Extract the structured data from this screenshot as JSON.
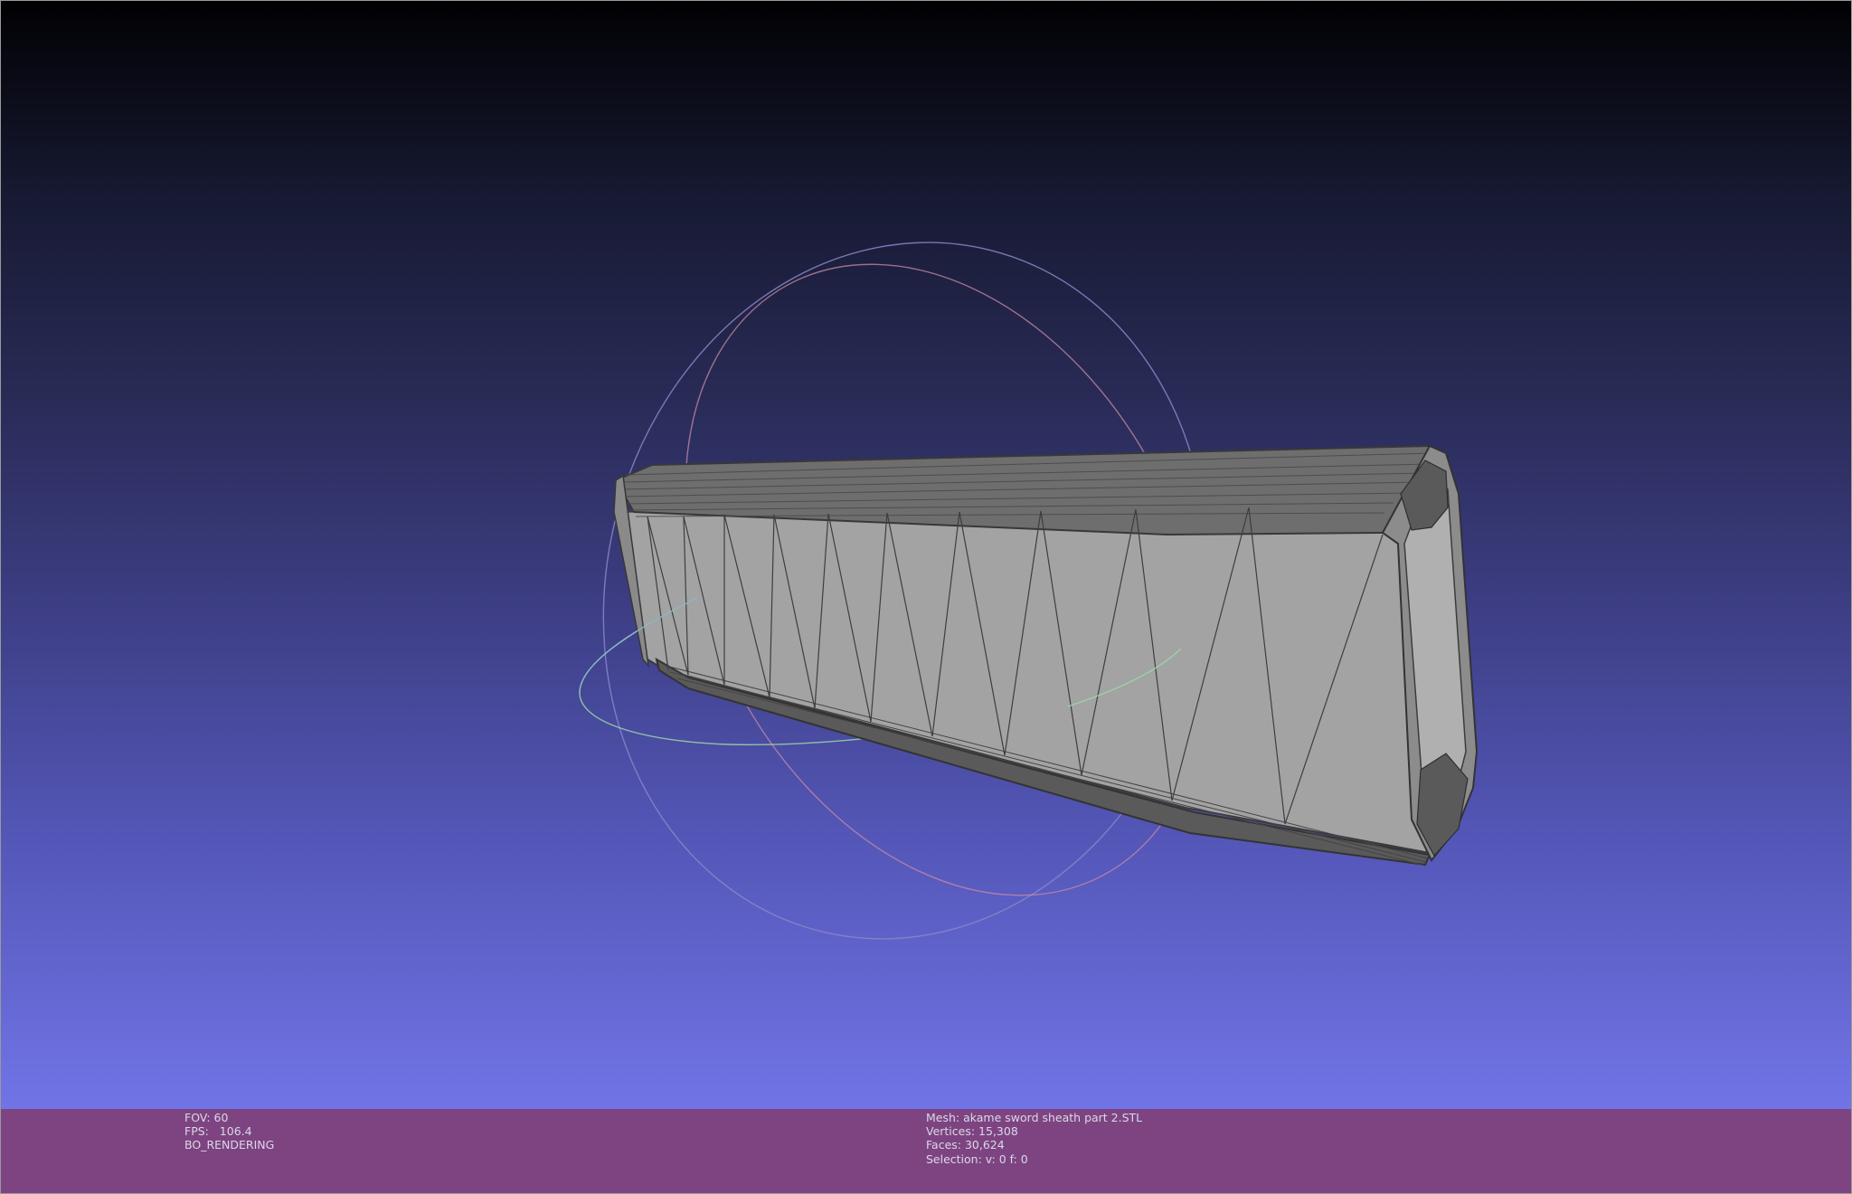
{
  "render_info": {
    "fov": "FOV: 60",
    "fps": "FPS:   106.4",
    "mode": "BO_RENDERING"
  },
  "mesh_info": {
    "mesh": "Mesh: akame sword sheath part 2.STL",
    "vertices": "Vertices: 15,308",
    "faces": "Faces: 30,624",
    "selection": "Selection: v: 0 f: 0"
  },
  "colors": {
    "background_top": "#010103",
    "background_bottom": "#7174e6",
    "info_bar": "#7e4482",
    "mesh_face": "#a0a0a0",
    "mesh_edge": "#3c3c3c",
    "trackball_red": "#c98aa6",
    "trackball_green": "#9ad6a8",
    "trackball_blue": "#8a86c8"
  },
  "icons": {
    "trackball": "trackball-gizmo",
    "model": "mesh-model"
  }
}
